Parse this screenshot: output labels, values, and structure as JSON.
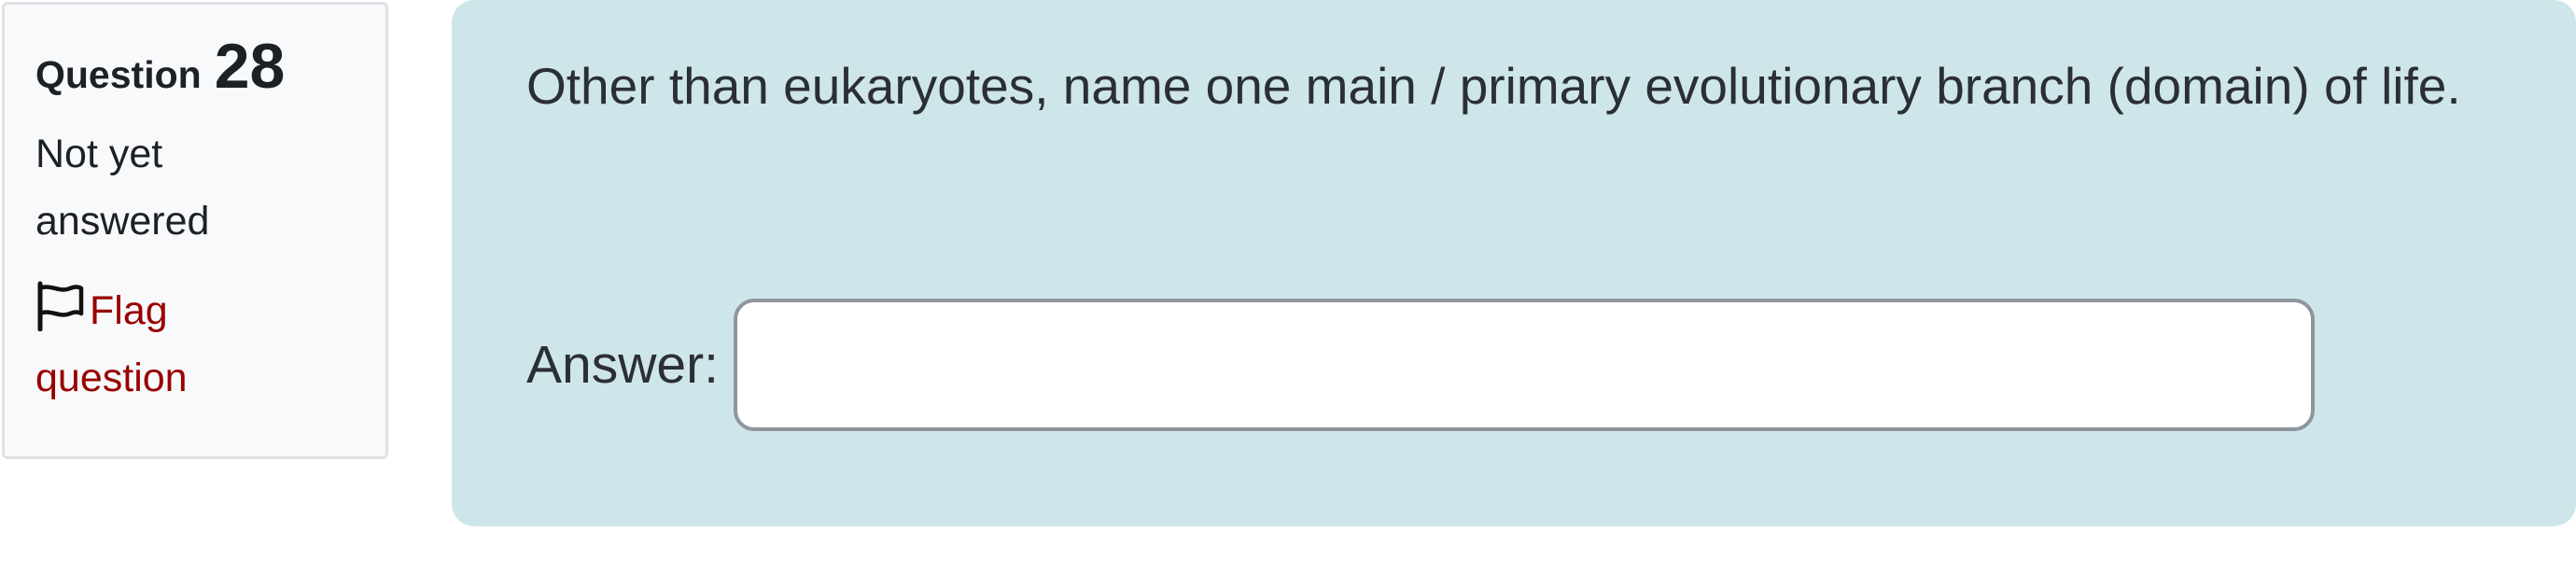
{
  "info": {
    "question_label": "Question",
    "question_number": "28",
    "state": "Not yet answered",
    "flag_label": "Flag question"
  },
  "question": {
    "text": "Other than eukaryotes, name one main / primary evolutionary branch (domain) of life.",
    "answer_label": "Answer:",
    "answer_value": ""
  },
  "icons": {
    "flag": "flag-icon"
  },
  "colors": {
    "info_bg": "#f8f9fa",
    "info_border": "#dee2e6",
    "content_bg": "#cee6ea",
    "flag_link": "#990000",
    "input_border": "#8f959e"
  }
}
